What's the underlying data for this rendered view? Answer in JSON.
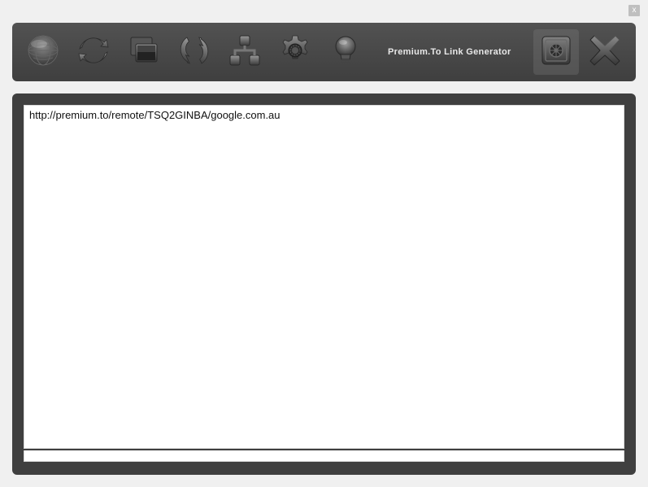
{
  "window": {
    "close_label": "x"
  },
  "toolbar": {
    "title": "Premium.To Link Generator",
    "icons": {
      "globe": "globe-icon",
      "sync": "sync-icon",
      "windows": "windows-icon",
      "refresh": "refresh-icon",
      "network": "network-icon",
      "gear": "gear-icon",
      "bulb": "bulb-icon",
      "safe": "safe-icon",
      "close": "close-x-icon"
    }
  },
  "content": {
    "url_value": "http://premium.to/remote/TSQ2GINBA/google.com.au"
  }
}
